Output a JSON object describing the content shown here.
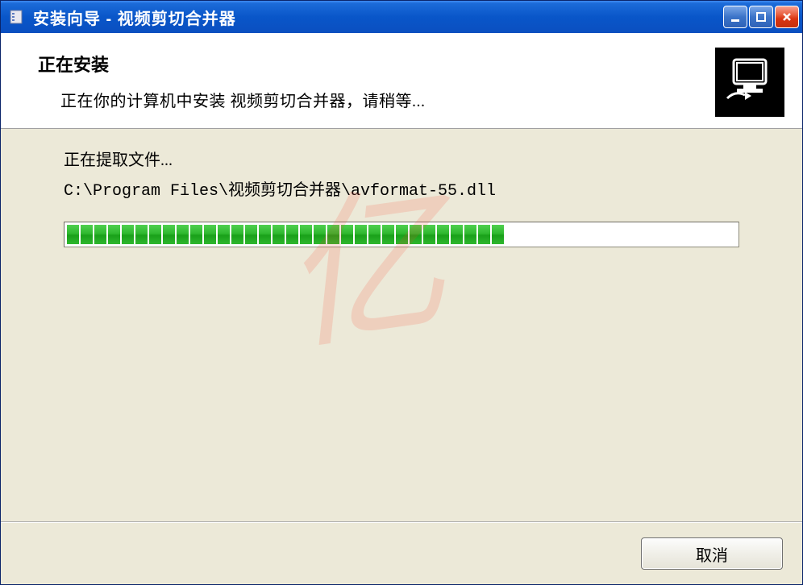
{
  "titlebar": {
    "title": "安装向导 - 视频剪切合并器"
  },
  "header": {
    "title": "正在安装",
    "subtitle": "正在你的计算机中安装 视频剪切合并器，请稍等..."
  },
  "content": {
    "extracting_label": "正在提取文件...",
    "current_file": "C:\\Program Files\\视频剪切合并器\\avformat-55.dll",
    "progress_chunks": 32
  },
  "footer": {
    "cancel_label": "取消"
  },
  "watermark": "亿"
}
